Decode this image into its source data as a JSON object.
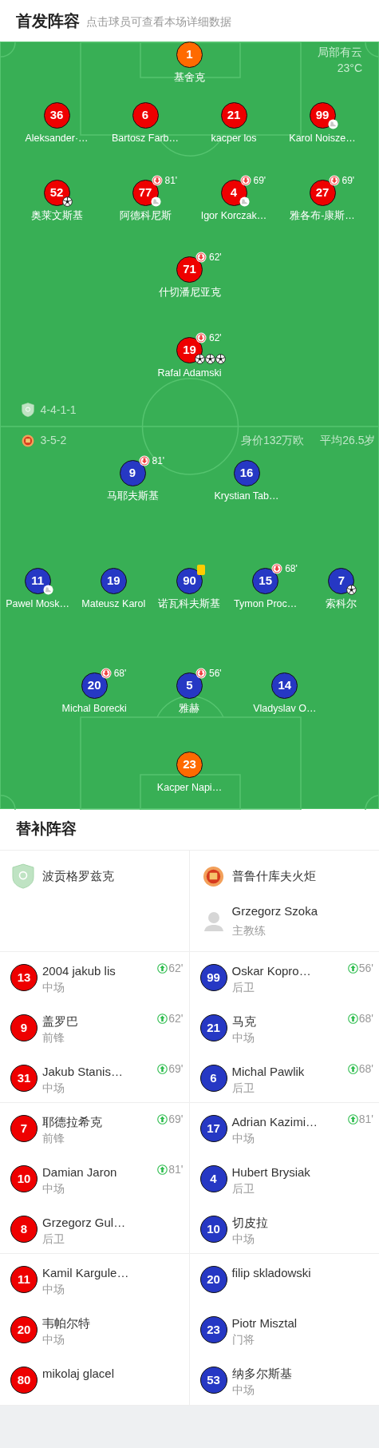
{
  "header": {
    "title": "首发阵容",
    "subtitle": "点击球员可查看本场详细数据"
  },
  "pitch": {
    "weather": "局部有云",
    "temperature": "23°C",
    "teams": [
      {
        "formation": "4-4-1-1",
        "color": "#ee0000",
        "lines": [
          {
            "players": [
              {
                "number": "1",
                "name": "基舍克",
                "kind": "goalkeeper"
              }
            ]
          },
          {
            "players": [
              {
                "number": "36",
                "name": "Aleksander·…",
                "kind": "outfield"
              },
              {
                "number": "6",
                "name": "Bartosz Farb…",
                "kind": "outfield"
              },
              {
                "number": "21",
                "name": "kacper los",
                "kind": "outfield"
              },
              {
                "number": "99",
                "name": "Karol Noisze…",
                "kind": "outfield",
                "events": [
                  {
                    "kind": "assist"
                  }
                ]
              }
            ]
          },
          {
            "players": [
              {
                "number": "52",
                "name": "奥莱文斯基",
                "kind": "outfield",
                "events": [
                  {
                    "kind": "goal"
                  }
                ]
              },
              {
                "number": "77",
                "name": "阿德科尼斯",
                "kind": "outfield",
                "events": [
                  {
                    "kind": "sub_out",
                    "minute": "81'"
                  },
                  {
                    "kind": "assist"
                  }
                ]
              },
              {
                "number": "4",
                "name": "Igor Korczak…",
                "kind": "outfield",
                "events": [
                  {
                    "kind": "sub_out",
                    "minute": "69'"
                  },
                  {
                    "kind": "assist"
                  }
                ]
              },
              {
                "number": "27",
                "name": "雅各布-康斯…",
                "kind": "outfield",
                "events": [
                  {
                    "kind": "sub_out",
                    "minute": "69'"
                  }
                ]
              }
            ]
          },
          {
            "players": [
              {
                "number": "71",
                "name": "什切潘尼亚克",
                "kind": "outfield",
                "events": [
                  {
                    "kind": "sub_out",
                    "minute": "62'"
                  }
                ]
              }
            ]
          },
          {
            "players": [
              {
                "number": "19",
                "name": "Rafal Adamski",
                "kind": "outfield",
                "events": [
                  {
                    "kind": "sub_out",
                    "minute": "62'"
                  },
                  {
                    "kind": "goal"
                  },
                  {
                    "kind": "goal"
                  },
                  {
                    "kind": "goal"
                  }
                ]
              }
            ]
          }
        ]
      },
      {
        "formation": "3-5-2",
        "value": "身价132万欧",
        "average_age": "平均26.5岁",
        "color": "#2638c4",
        "lines": [
          {
            "players": [
              {
                "number": "9",
                "name": "马耶夫斯基",
                "kind": "outfield",
                "events": [
                  {
                    "kind": "sub_out",
                    "minute": "81'"
                  }
                ]
              },
              {
                "number": "16",
                "name": "Krystian Tab…",
                "kind": "outfield"
              }
            ]
          },
          {
            "players": [
              {
                "number": "11",
                "name": "Pawel Mosk…",
                "kind": "outfield",
                "events": [
                  {
                    "kind": "assist"
                  }
                ]
              },
              {
                "number": "19",
                "name": "Mateusz Karol",
                "kind": "outfield"
              },
              {
                "number": "90",
                "name": "诺瓦科夫斯基",
                "kind": "outfield",
                "events": [
                  {
                    "kind": "yellow_card"
                  }
                ]
              },
              {
                "number": "15",
                "name": "Tymon Proc…",
                "kind": "outfield",
                "events": [
                  {
                    "kind": "sub_out",
                    "minute": "68'"
                  }
                ]
              },
              {
                "number": "7",
                "name": "索科尔",
                "kind": "outfield",
                "events": [
                  {
                    "kind": "goal"
                  }
                ]
              }
            ]
          },
          {
            "players": [
              {
                "number": "20",
                "name": "Michal Borecki",
                "kind": "outfield",
                "events": [
                  {
                    "kind": "sub_out",
                    "minute": "68'"
                  }
                ]
              },
              {
                "number": "5",
                "name": "雅赫",
                "kind": "outfield",
                "events": [
                  {
                    "kind": "sub_out",
                    "minute": "56'"
                  }
                ]
              },
              {
                "number": "14",
                "name": "Vladyslav O…",
                "kind": "outfield"
              }
            ]
          },
          {
            "players": [
              {
                "number": "23",
                "name": "Kacper Napi…",
                "kind": "goalkeeper"
              }
            ]
          }
        ]
      }
    ]
  },
  "substitutes": {
    "title": "替补阵容",
    "teams": [
      {
        "name": "波贡格罗兹克",
        "players": [
          {
            "number": "13",
            "name": "2004 jakub lis",
            "position": "中场",
            "sub_in": "62'"
          },
          {
            "number": "9",
            "name": "盖罗巴",
            "position": "前锋",
            "sub_in": "62'"
          },
          {
            "number": "31",
            "name": "Jakub Stanis…",
            "position": "中场",
            "sub_in": "69'"
          },
          {
            "number": "7",
            "name": "耶德拉希克",
            "position": "前锋",
            "sub_in": "69'"
          },
          {
            "number": "10",
            "name": "Damian Jaron",
            "position": "中场",
            "sub_in": "81'"
          },
          {
            "number": "8",
            "name": "Grzegorz Gul…",
            "position": "后卫"
          },
          {
            "number": "11",
            "name": "Kamil Kargule…",
            "position": "中场"
          },
          {
            "number": "20",
            "name": "韦帕尔特",
            "position": "中场"
          },
          {
            "number": "80",
            "name": "mikolaj glacel"
          }
        ]
      },
      {
        "name": "普鲁什库夫火炬",
        "coach": {
          "name": "Grzegorz Szoka",
          "role": "主教练"
        },
        "players": [
          {
            "number": "99",
            "name": "Oskar Kopro…",
            "position": "后卫",
            "sub_in": "56'"
          },
          {
            "number": "21",
            "name": "马克",
            "position": "中场",
            "sub_in": "68'"
          },
          {
            "number": "6",
            "name": "Michal Pawlik",
            "position": "后卫",
            "sub_in": "68'"
          },
          {
            "number": "17",
            "name": "Adrian Kazimi…",
            "position": "中场",
            "sub_in": "81'"
          },
          {
            "number": "4",
            "name": "Hubert Brysiak",
            "position": "后卫"
          },
          {
            "number": "10",
            "name": "切皮拉",
            "position": "中场"
          },
          {
            "number": "20",
            "name": "filip skladowski"
          },
          {
            "number": "23",
            "name": "Piotr Misztal",
            "position": "门将"
          },
          {
            "number": "53",
            "name": "纳多尔斯基",
            "position": "中场"
          }
        ]
      }
    ]
  }
}
